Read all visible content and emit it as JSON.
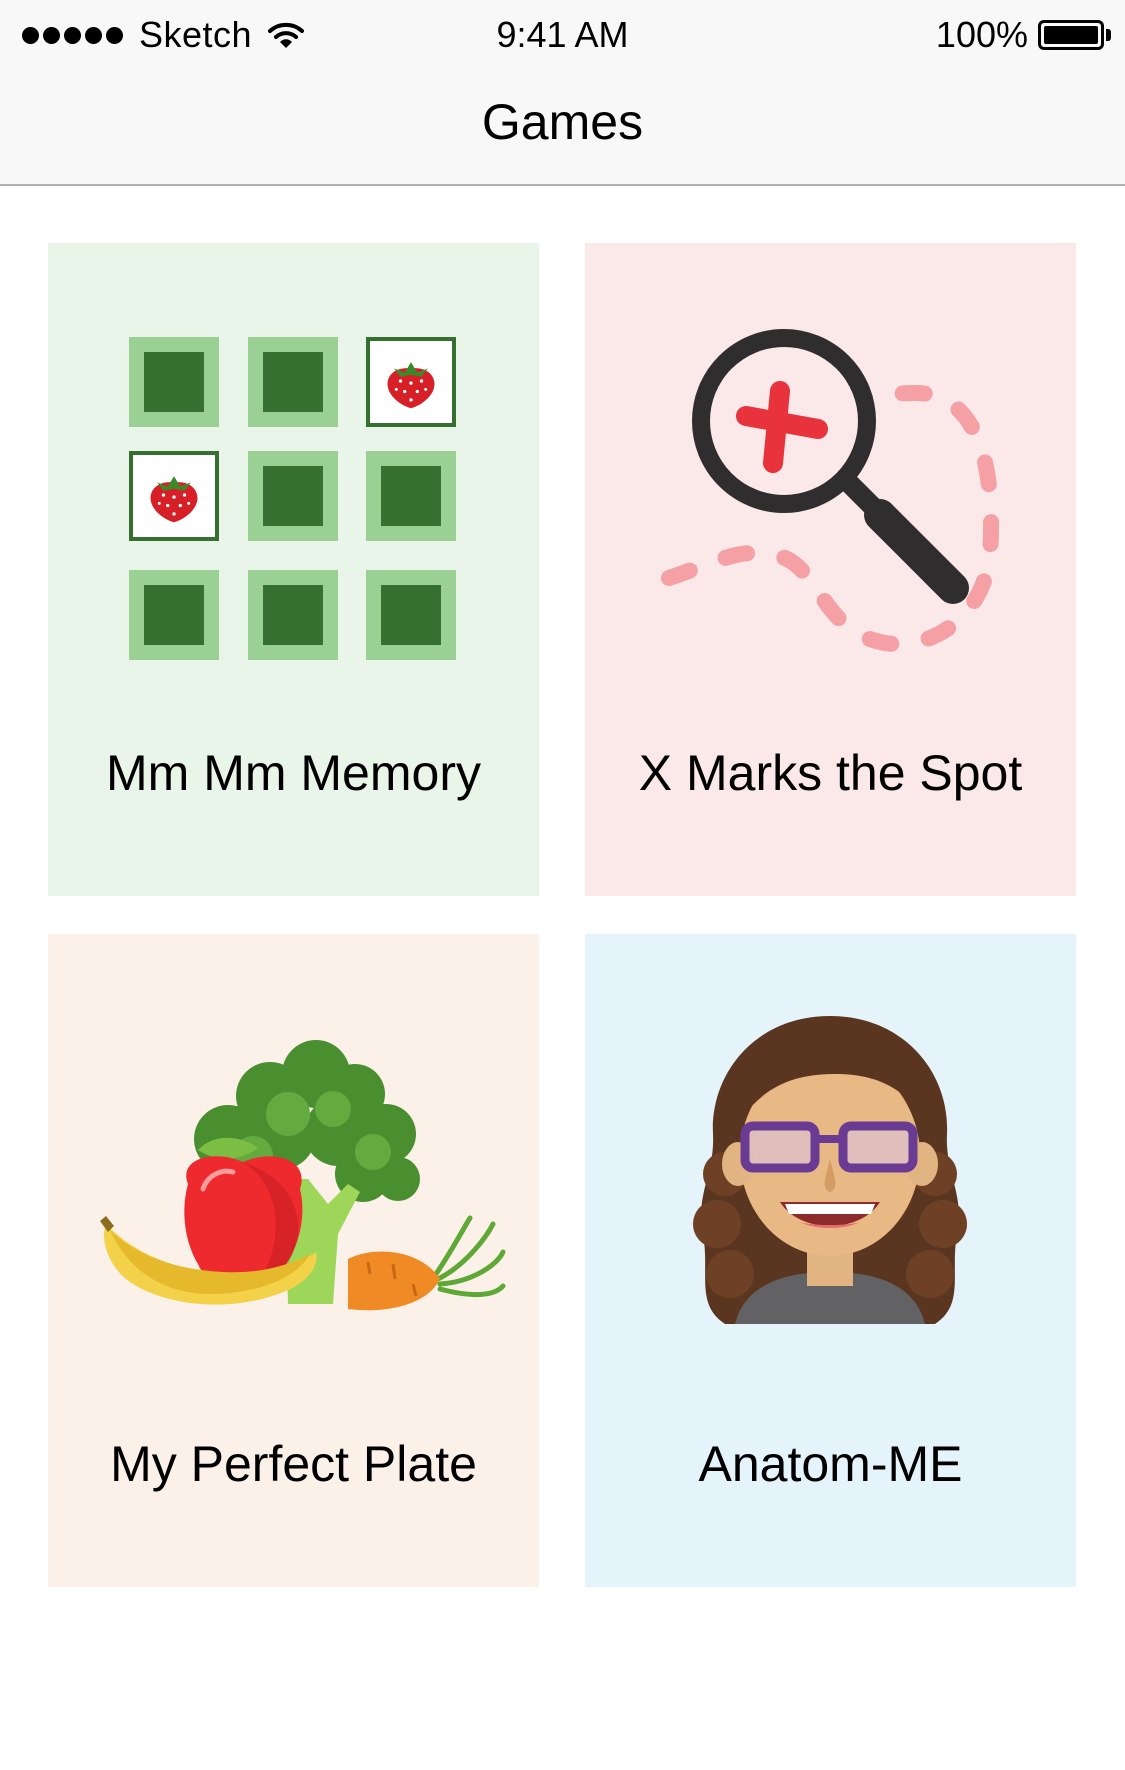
{
  "status_bar": {
    "carrier": "Sketch",
    "time": "9:41 AM",
    "battery": "100%",
    "signal_icon": "signal-dots-icon",
    "wifi_icon": "wifi-icon",
    "battery_icon": "battery-icon"
  },
  "nav": {
    "title": "Games"
  },
  "cards": [
    {
      "title": "Mm Mm Memory",
      "background": "#eaf5e9",
      "icon": "memory-grid-icon"
    },
    {
      "title": "X Marks the Spot",
      "background": "#fbe9ea",
      "icon": "magnifier-treasure-map-icon"
    },
    {
      "title": "My Perfect Plate",
      "background": "#fbf1e8",
      "icon": "fruit-vegetables-icon"
    },
    {
      "title": "Anatom-ME",
      "background": "#e5f4fa",
      "icon": "avatar-girl-icon"
    }
  ],
  "colors": {
    "memory_tile_dark": "#357030",
    "memory_tile_light": "#9bd095",
    "strawberry": "#d61f26",
    "magnifier": "#2f2d2e",
    "x_mark": "#e8333c",
    "trail": "#f4a0a5"
  }
}
